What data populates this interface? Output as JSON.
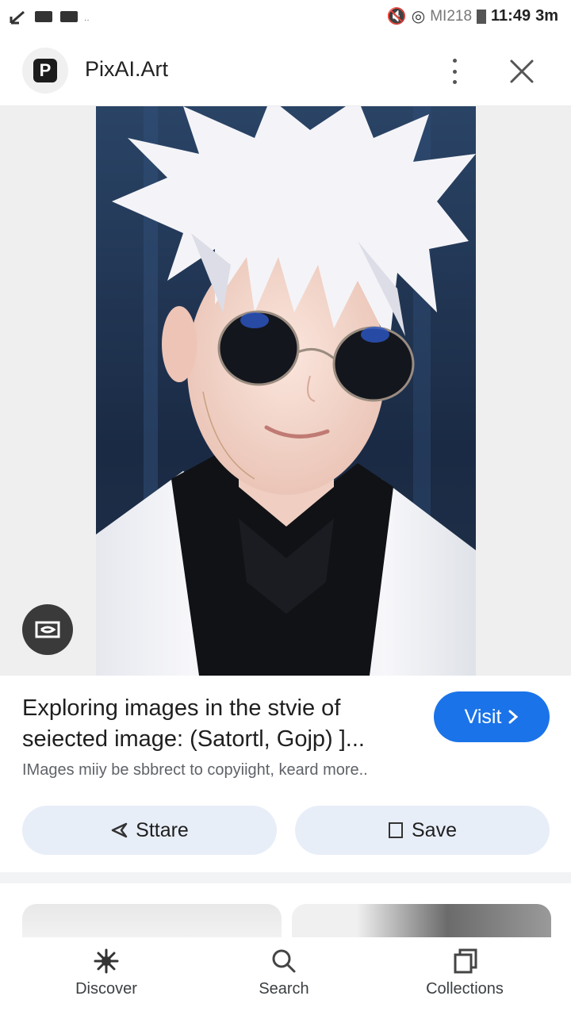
{
  "status_bar": {
    "network": "MI218",
    "time": "11:49",
    "suffix": "3m"
  },
  "header": {
    "logo_letter": "P",
    "site_name": "PixAI.Art"
  },
  "result": {
    "title": "Exploring images in the stvie of seiected image: (Satortl, Gojp) ]...",
    "visit_label": "Visit",
    "copyright_note": "IMages miiy be sbbrect to copyiight, keard more..",
    "share_label": "Sttare",
    "save_label": "Save"
  },
  "bottom_nav": {
    "items": [
      {
        "label": "Discover",
        "icon": "discover-icon"
      },
      {
        "label": "Search",
        "icon": "search-icon"
      },
      {
        "label": "Collections",
        "icon": "collections-icon"
      }
    ]
  },
  "colors": {
    "accent": "#1a73e8",
    "chip_bg": "#e8eef8",
    "image_bg": "#efefef"
  }
}
